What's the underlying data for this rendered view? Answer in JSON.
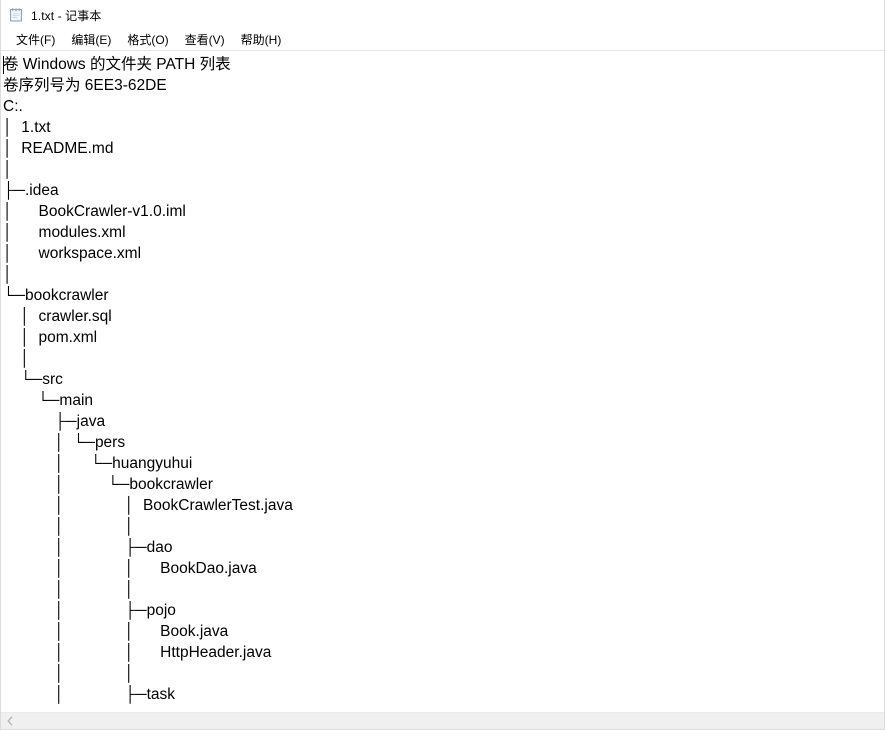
{
  "window": {
    "title": "1.txt - 记事本",
    "icon": "notepad-icon"
  },
  "menubar": {
    "items": [
      {
        "label": "文件(F)",
        "name": "menu-file"
      },
      {
        "label": "编辑(E)",
        "name": "menu-edit"
      },
      {
        "label": "格式(O)",
        "name": "menu-format"
      },
      {
        "label": "查看(V)",
        "name": "menu-view"
      },
      {
        "label": "帮助(H)",
        "name": "menu-help"
      }
    ]
  },
  "editor": {
    "lines": [
      "卷 Windows 的文件夹 PATH 列表",
      "卷序列号为 6EE3-62DE",
      "C:.",
      "│  1.txt",
      "│  README.md",
      "│",
      "├─.idea",
      "│      BookCrawler-v1.0.iml",
      "│      modules.xml",
      "│      workspace.xml",
      "│",
      "└─bookcrawler",
      "    │  crawler.sql",
      "    │  pom.xml",
      "    │",
      "    └─src",
      "        └─main",
      "            ├─java",
      "            │  └─pers",
      "            │      └─huangyuhui",
      "            │          └─bookcrawler",
      "            │              │  BookCrawlerTest.java",
      "            │              │",
      "            │              ├─dao",
      "            │              │      BookDao.java",
      "            │              │",
      "            │              ├─pojo",
      "            │              │      Book.java",
      "            │              │      HttpHeader.java",
      "            │              │",
      "            │              ├─task"
    ]
  },
  "scrollbar": {
    "left_arrow": "chevron-left-icon",
    "orientation": "horizontal"
  },
  "colors": {
    "window_bg": "#ffffff",
    "text": "#000000",
    "scrollbar_bg": "#f0f0f0",
    "menu_hover": "#cde8ff"
  }
}
